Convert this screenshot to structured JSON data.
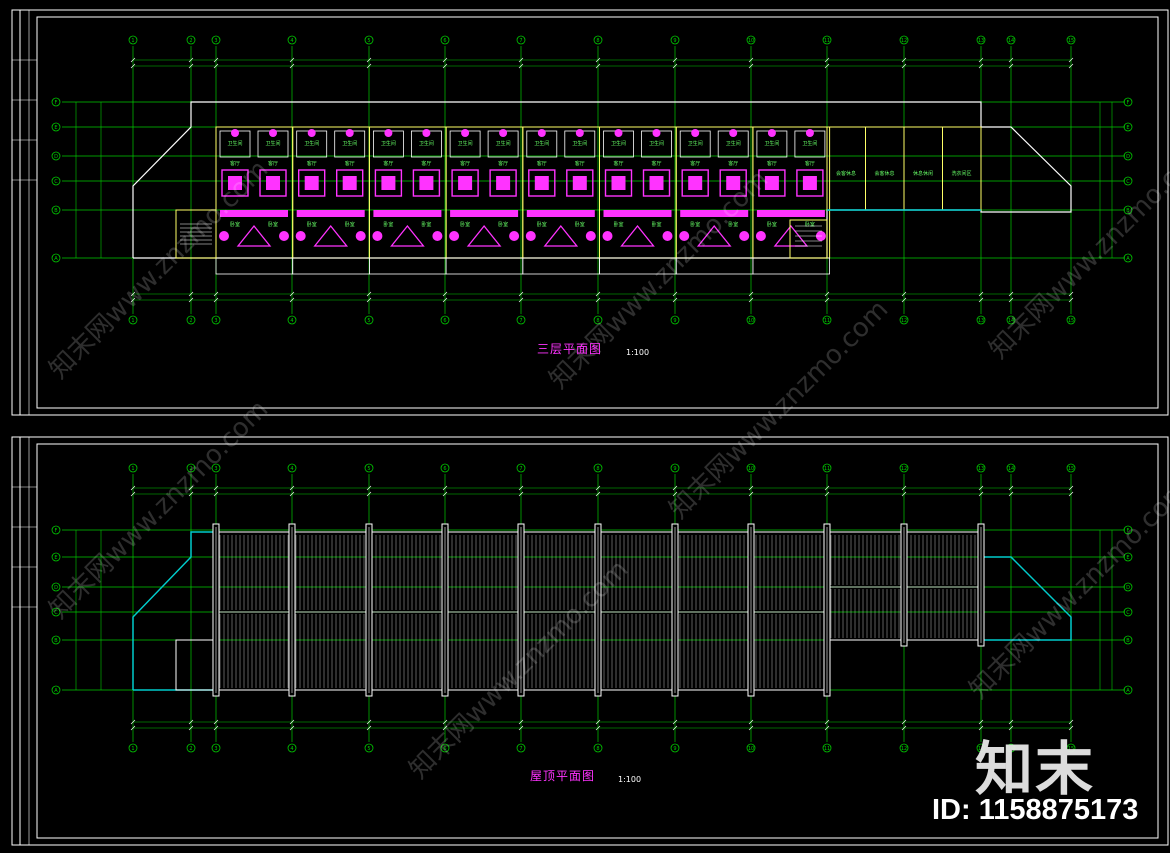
{
  "sheets": [
    {
      "title": "三层平面图",
      "scale": "1:100",
      "room_labels": [
        "卫生间",
        "卫生间",
        "客厅",
        "客厅",
        "卧室",
        "卧室"
      ],
      "east_room_labels": [
        "会客休息",
        "会客休息",
        "休息休闲",
        "洗衣间区"
      ]
    },
    {
      "title": "屋顶平面图",
      "scale": "1:100"
    }
  ],
  "grid": {
    "column_labels": [
      "1",
      "2",
      "3",
      "4",
      "5",
      "6",
      "7",
      "8",
      "9",
      "10",
      "11",
      "12",
      "13",
      "14",
      "15"
    ],
    "row_labels": [
      "F",
      "E",
      "D",
      "C",
      "B",
      "A"
    ]
  },
  "watermark": {
    "logo_text": "知末",
    "id_text": "ID: 1158875173",
    "diagonal_text": "知末网www.znzmo.com"
  },
  "colors": {
    "background": "#000000",
    "grid_lines": "#00cc00",
    "walls": "#ffffff",
    "furniture": "#ff33ff",
    "room_text": "#66ff66",
    "columns": "#ffff66",
    "roof_edge": "#00cccc",
    "frame": "#ffffff"
  }
}
